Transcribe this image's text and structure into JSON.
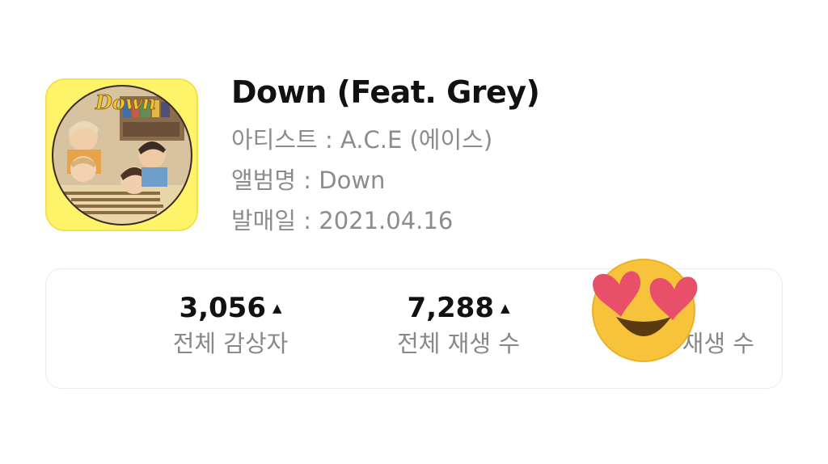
{
  "song": {
    "title": "Down (Feat. Grey)",
    "artist_line": "아티스트 : A.C.E (에이스)",
    "album_line": "앨범명 : Down",
    "release_line": "발매일 : 2021.04.16"
  },
  "album_art": {
    "text": "Down",
    "background_color": "#fff36a"
  },
  "stats": [
    {
      "value": "3,056",
      "label": "전체 감상자",
      "trend_icon": "triangle-up-icon"
    },
    {
      "value": "7,288",
      "label": "전체 재생 수",
      "trend_icon": "triangle-up-icon"
    },
    {
      "value": "",
      "label": "나의 재생 수"
    }
  ],
  "sticker": {
    "icon": "heart-eyes-emoji-icon",
    "face_color": "#f6c33a",
    "heart_color": "#e8506a"
  }
}
